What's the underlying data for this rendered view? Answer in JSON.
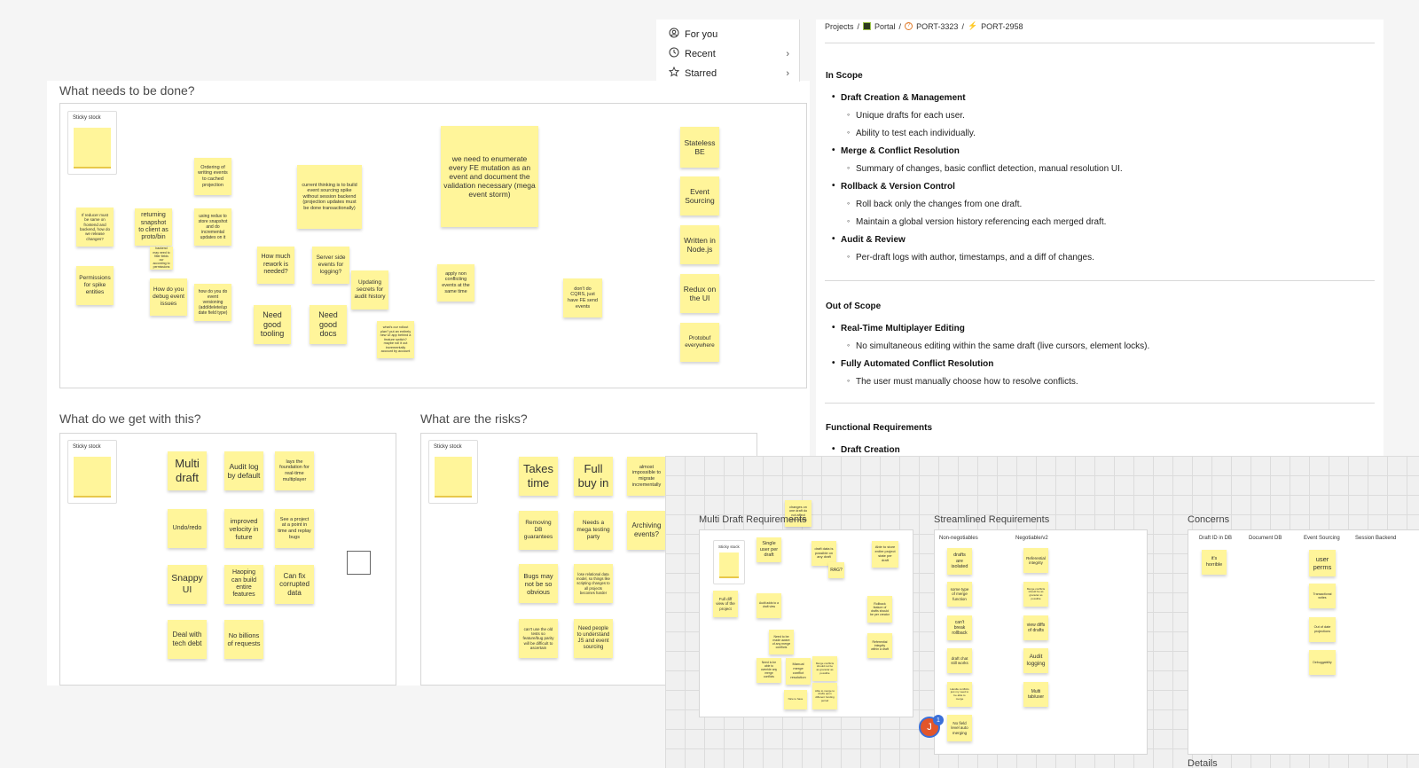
{
  "sidebar": {
    "items": [
      {
        "label": "For you",
        "icon": "user-circle-icon"
      },
      {
        "label": "Recent",
        "icon": "clock-icon"
      },
      {
        "label": "Starred",
        "icon": "star-icon"
      }
    ]
  },
  "breadcrumb": {
    "items": [
      "Projects",
      "Portal",
      "PORT-3323",
      "PORT-2958"
    ]
  },
  "doc": {
    "in_scope": {
      "heading": "In Scope",
      "items": [
        {
          "title": "Draft Creation & Management",
          "subs": [
            "Unique drafts for each user.",
            "Ability to test each individually."
          ]
        },
        {
          "title": "Merge & Conflict Resolution",
          "subs": [
            "Summary of changes, basic conflict detection, manual resolution UI."
          ]
        },
        {
          "title": "Rollback & Version Control",
          "subs": [
            "Roll back only the changes from one draft.",
            "Maintain a global version history referencing each merged draft."
          ]
        },
        {
          "title": "Audit & Review",
          "subs": [
            "Per-draft logs with author, timestamps, and a diff of changes."
          ]
        }
      ]
    },
    "out_scope": {
      "heading": "Out of Scope",
      "items": [
        {
          "title": "Real-Time Multiplayer Editing",
          "subs": [
            "No simultaneous editing within the same draft (live cursors, element locks)."
          ]
        },
        {
          "title": "Fully Automated Conflict Resolution",
          "subs": [
            "The user must manually choose how to resolve conflicts."
          ]
        }
      ]
    },
    "functional": {
      "heading": "Functional Requirements",
      "items": [
        {
          "title": "Draft Creation"
        }
      ]
    }
  },
  "board": {
    "sections": {
      "todo": "What needs to be done?",
      "gain": "What do we get with this?",
      "risks": "What are the risks?"
    },
    "sticky_stock_label": "Sticky stock"
  },
  "todo_notes": [
    "If reducer must be same on frontend and backend, how do we release changes?",
    "returning snapshot to client as proto/bin",
    "backend may need to filter fields our according to permissions",
    "Ordering of writing events to cached projection",
    "using redux to store snapshot and do incremental updates on it",
    "current thinking is to build event sourcing spike without session backend (projection updates must be done transactionally)",
    "we need to enumerate every FE mutation as an event and document the validation necessary (mega event storm)",
    "Permissions for spike entities",
    "How do you debug event issues",
    "how do you do event versioning (add/delete/up date field type)",
    "How much rework is needed?",
    "Server side events for logging?",
    "Updating secrets for audit history",
    "apply non conflicting events at the same time",
    "don't do CQRS, just have FE send events",
    "Need good tooling",
    "Need good docs",
    "what's our rollout plan? put an entirely new UI app behind a feature switch? maybe roll it out incrementally account by account",
    "Stateless BE",
    "Event Sourcing",
    "Written in Node.js",
    "Redux on the UI",
    "Protobuf everywhere"
  ],
  "gain_notes": [
    "Multi draft",
    "Audit log by default",
    "lays the foundation for real-time multiplayer",
    "Undo/redo",
    "improved velocity in future",
    "See a project at a point in time and replay bugs",
    "Snappy UI",
    "Haoping can build entire features",
    "Can fix corrupted data",
    "Deal with tech debt",
    "No billions of requests"
  ],
  "risk_notes": [
    "Takes time",
    "Full buy in",
    "almost impossible to migrate incrementally",
    "Removing DB guarantees",
    "Needs a mega testing party",
    "Archiving events?",
    "Bugs may not be so obvious",
    "lose relational data model, so things like scripting changes to all projects becomes harder",
    "can't use the old tests so feature/bug parity will be difficult to ascertain",
    "Need people to understand JS and event sourcing"
  ],
  "lower_board": {
    "multi_draft_title": "Multi Draft Requirements",
    "streamlined_title": "Streamlined Requirements",
    "concerns_title": "Concerns",
    "details_title": "Details",
    "floating_note": "changes on one draft do not affect other drafts",
    "multi_draft_notes": [
      "Single user per draft",
      "draft data is possible on any draft",
      "Able to store entire project state per draft",
      "RAG?",
      "Full diff view of the project",
      "Audit adds to a draft view",
      "Rollback feature of drafts should be per creator",
      "Need to be made aware of any merge conflicts",
      "Referential integrity within a draft",
      "Need to be able to override any merge conflicts",
      "Manual merge conflict resolution",
      "Merge conflicts should not be as granular as possible",
      "Able to merge to drafts upon different funding period",
      "Nice to have"
    ],
    "streamlined_cols": [
      "Non-negotiables",
      "Negotiable/v2"
    ],
    "streamlined_notes_left": [
      "drafts are isolated",
      "some type of merge function",
      "can't break rollback",
      "draft chat still works",
      "Handle conflicts just my need to be able to merge",
      "No field level auto merging"
    ],
    "streamlined_notes_right": [
      "Referential integrity",
      "Merge conflicts should be as granular as possible",
      "view diffs of drafts",
      "Audit logging",
      "Multi tab/user"
    ],
    "concerns_cols": [
      "Draft ID in DB",
      "Document DB",
      "Event Sourcing",
      "Session Backend"
    ],
    "concerns_notes_col1": [
      "it's horrible"
    ],
    "concerns_notes_col3": [
      "user perms",
      "Transactional writes",
      "Out of date projections",
      "Debuggability"
    ]
  },
  "presence": {
    "avatar_letter": "J",
    "badge": "1"
  }
}
